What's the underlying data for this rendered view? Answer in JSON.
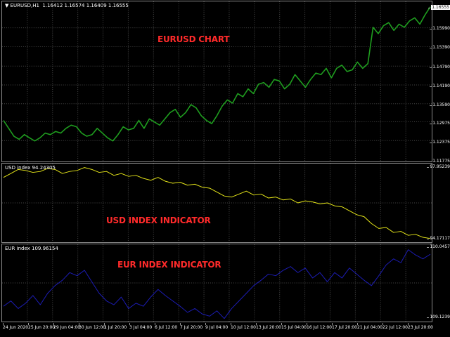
{
  "main_pane": {
    "label": "▼ EURUSD,H1  1.16412 1.16574 1.16409 1.16555",
    "caption": "EURUSD CHART",
    "price_ticks": [
      "1.16555",
      "1.15990",
      "1.15390",
      "1.14790",
      "1.14190",
      "1.13590",
      "1.12975",
      "1.12375",
      "1.11775"
    ],
    "series": {
      "name": "EURUSD",
      "color": "#1f9e1f",
      "ylim": [
        1.1165,
        1.1672
      ],
      "values": [
        1.1295,
        1.127,
        1.1245,
        1.1235,
        1.125,
        1.124,
        1.123,
        1.124,
        1.1255,
        1.125,
        1.126,
        1.1255,
        1.127,
        1.128,
        1.1275,
        1.1255,
        1.1245,
        1.125,
        1.127,
        1.1255,
        1.124,
        1.123,
        1.125,
        1.1275,
        1.1265,
        1.127,
        1.1295,
        1.127,
        1.13,
        1.129,
        1.128,
        1.13,
        1.132,
        1.133,
        1.1305,
        1.132,
        1.1345,
        1.1335,
        1.131,
        1.1295,
        1.1285,
        1.131,
        1.134,
        1.136,
        1.135,
        1.138,
        1.137,
        1.1395,
        1.138,
        1.141,
        1.1415,
        1.14,
        1.1425,
        1.142,
        1.1395,
        1.141,
        1.144,
        1.142,
        1.14,
        1.1425,
        1.1445,
        1.144,
        1.146,
        1.143,
        1.146,
        1.147,
        1.145,
        1.1455,
        1.148,
        1.146,
        1.1475,
        1.159,
        1.157,
        1.1595,
        1.1605,
        1.158,
        1.16,
        1.159,
        1.161,
        1.162,
        1.16,
        1.163,
        1.1655
      ]
    }
  },
  "usd_pane": {
    "label": "USD index 94.24305",
    "caption": "USD INDEX INDICATOR",
    "price_ticks": [
      "97.95239",
      "94.17117"
    ],
    "series": {
      "name": "USD index",
      "color": "#e6e619",
      "ylim": [
        94.05,
        98.05
      ],
      "values": [
        97.35,
        97.55,
        97.75,
        97.7,
        97.6,
        97.65,
        97.8,
        97.75,
        97.55,
        97.65,
        97.7,
        97.85,
        97.75,
        97.6,
        97.65,
        97.45,
        97.55,
        97.4,
        97.45,
        97.3,
        97.2,
        97.35,
        97.15,
        97.05,
        97.1,
        96.95,
        97.0,
        96.85,
        96.8,
        96.6,
        96.4,
        96.35,
        96.5,
        96.65,
        96.45,
        96.5,
        96.3,
        96.35,
        96.2,
        96.25,
        96.05,
        96.15,
        96.1,
        96.0,
        96.05,
        95.9,
        95.85,
        95.65,
        95.45,
        95.35,
        95.0,
        94.75,
        94.8,
        94.55,
        94.6,
        94.4,
        94.45,
        94.3,
        94.24
      ]
    }
  },
  "eur_pane": {
    "label": "EUR index 109.96154",
    "caption": "EUR INDEX INDICATOR",
    "price_ticks": [
      "110.0457",
      "109.1239"
    ],
    "series": {
      "name": "EUR index",
      "color": "#1c1cb4",
      "ylim": [
        109.08,
        110.09
      ],
      "values": [
        109.28,
        109.35,
        109.25,
        109.32,
        109.42,
        109.3,
        109.45,
        109.55,
        109.62,
        109.72,
        109.68,
        109.75,
        109.6,
        109.45,
        109.35,
        109.3,
        109.4,
        109.25,
        109.32,
        109.28,
        109.4,
        109.5,
        109.42,
        109.35,
        109.28,
        109.2,
        109.25,
        109.18,
        109.15,
        109.22,
        109.12,
        109.25,
        109.35,
        109.45,
        109.55,
        109.62,
        109.7,
        109.68,
        109.75,
        109.8,
        109.72,
        109.78,
        109.65,
        109.72,
        109.6,
        109.72,
        109.65,
        109.78,
        109.7,
        109.62,
        109.55,
        109.68,
        109.82,
        109.9,
        109.85,
        110.02,
        109.95,
        109.9,
        109.96
      ]
    }
  },
  "time_axis": {
    "labels": [
      "24 Jun 2020",
      "25 Jun 20:00",
      "29 Jun 04:00",
      "30 Jun 12:00",
      "1 Jul 20:00",
      "3 Jul 04:00",
      "6 Jul 12:00",
      "7 Jul 20:00",
      "9 Jul 04:00",
      "10 Jul 12:00",
      "13 Jul 20:00",
      "15 Jul 04:00",
      "16 Jul 12:00",
      "17 Jul 20:00",
      "21 Jul 04:00",
      "22 Jul 12:00",
      "23 Jul 20:00"
    ]
  },
  "colors": {
    "background": "#000000",
    "grid": "#4a4a4a",
    "caption": "#ff2a2a",
    "axis_text": "#ffffff"
  }
}
